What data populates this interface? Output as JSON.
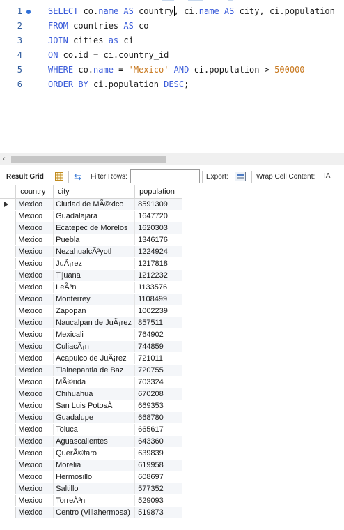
{
  "editor": {
    "lines": [
      {
        "num": "1",
        "parts": [
          {
            "k": "kw",
            "t": "SELECT"
          },
          {
            "k": "tx",
            "t": " co."
          },
          {
            "k": "kw",
            "t": "name"
          },
          {
            "k": "tx",
            "t": " "
          },
          {
            "k": "kw",
            "t": "AS"
          },
          {
            "k": "tx",
            "t": " country"
          },
          {
            "k": "caret",
            "t": ""
          },
          {
            "k": "tx",
            "t": ", ci."
          },
          {
            "k": "kw",
            "t": "name"
          },
          {
            "k": "tx",
            "t": " "
          },
          {
            "k": "kw",
            "t": "AS"
          },
          {
            "k": "tx",
            "t": " city, ci.population"
          }
        ]
      },
      {
        "num": "2",
        "parts": [
          {
            "k": "kw",
            "t": "FROM"
          },
          {
            "k": "tx",
            "t": " countries "
          },
          {
            "k": "kw",
            "t": "AS"
          },
          {
            "k": "tx",
            "t": " co"
          }
        ]
      },
      {
        "num": "3",
        "parts": [
          {
            "k": "kw",
            "t": "JOIN"
          },
          {
            "k": "tx",
            "t": " cities "
          },
          {
            "k": "kw",
            "t": "as"
          },
          {
            "k": "tx",
            "t": " ci"
          }
        ]
      },
      {
        "num": "4",
        "parts": [
          {
            "k": "kw",
            "t": "ON"
          },
          {
            "k": "tx",
            "t": " co.id = ci.country_id"
          }
        ]
      },
      {
        "num": "5",
        "parts": [
          {
            "k": "kw",
            "t": "WHERE"
          },
          {
            "k": "tx",
            "t": " co."
          },
          {
            "k": "kw",
            "t": "name"
          },
          {
            "k": "tx",
            "t": " = "
          },
          {
            "k": "str",
            "t": "'Mexico'"
          },
          {
            "k": "tx",
            "t": " "
          },
          {
            "k": "kw",
            "t": "AND"
          },
          {
            "k": "tx",
            "t": " ci.population > "
          },
          {
            "k": "num",
            "t": "500000"
          }
        ]
      },
      {
        "num": "6",
        "parts": [
          {
            "k": "kw",
            "t": "ORDER BY"
          },
          {
            "k": "tx",
            "t": " ci.population "
          },
          {
            "k": "kw",
            "t": "DESC"
          },
          {
            "k": "tx",
            "t": ";"
          }
        ]
      }
    ]
  },
  "toolbar": {
    "result_grid_label": "Result Grid",
    "filter_rows_label": "Filter Rows:",
    "filter_value": "",
    "export_label": "Export:",
    "wrap_label": "Wrap Cell Content:",
    "wrap_icon_text": "IA"
  },
  "grid": {
    "columns": [
      "country",
      "city",
      "population"
    ],
    "rows": [
      [
        "Mexico",
        "Ciudad de MÃ©xico",
        "8591309"
      ],
      [
        "Mexico",
        "Guadalajara",
        "1647720"
      ],
      [
        "Mexico",
        "Ecatepec de Morelos",
        "1620303"
      ],
      [
        "Mexico",
        "Puebla",
        "1346176"
      ],
      [
        "Mexico",
        "NezahualcÃ³yotl",
        "1224924"
      ],
      [
        "Mexico",
        "JuÃ¡rez",
        "1217818"
      ],
      [
        "Mexico",
        "Tijuana",
        "1212232"
      ],
      [
        "Mexico",
        "LeÃ³n",
        "1133576"
      ],
      [
        "Mexico",
        "Monterrey",
        "1108499"
      ],
      [
        "Mexico",
        "Zapopan",
        "1002239"
      ],
      [
        "Mexico",
        "Naucalpan de JuÃ¡rez",
        "857511"
      ],
      [
        "Mexico",
        "Mexicali",
        "764902"
      ],
      [
        "Mexico",
        "CuliacÃ¡n",
        "744859"
      ],
      [
        "Mexico",
        "Acapulco de JuÃ¡rez",
        "721011"
      ],
      [
        "Mexico",
        "Tlalnepantla de Baz",
        "720755"
      ],
      [
        "Mexico",
        "MÃ©rida",
        "703324"
      ],
      [
        "Mexico",
        "Chihuahua",
        "670208"
      ],
      [
        "Mexico",
        "San Luis PotosÃ­",
        "669353"
      ],
      [
        "Mexico",
        "Guadalupe",
        "668780"
      ],
      [
        "Mexico",
        "Toluca",
        "665617"
      ],
      [
        "Mexico",
        "Aguascalientes",
        "643360"
      ],
      [
        "Mexico",
        "QuerÃ©taro",
        "639839"
      ],
      [
        "Mexico",
        "Morelia",
        "619958"
      ],
      [
        "Mexico",
        "Hermosillo",
        "608697"
      ],
      [
        "Mexico",
        "Saltillo",
        "577352"
      ],
      [
        "Mexico",
        "TorreÃ³n",
        "529093"
      ],
      [
        "Mexico",
        "Centro (Villahermosa)",
        "519873"
      ]
    ],
    "selected_row": 0
  },
  "colors": {
    "keyword": "#3a5bd9",
    "string": "#c8781e",
    "line_number": "#2f5b9e",
    "row_stripe": "#f4f6f9"
  }
}
